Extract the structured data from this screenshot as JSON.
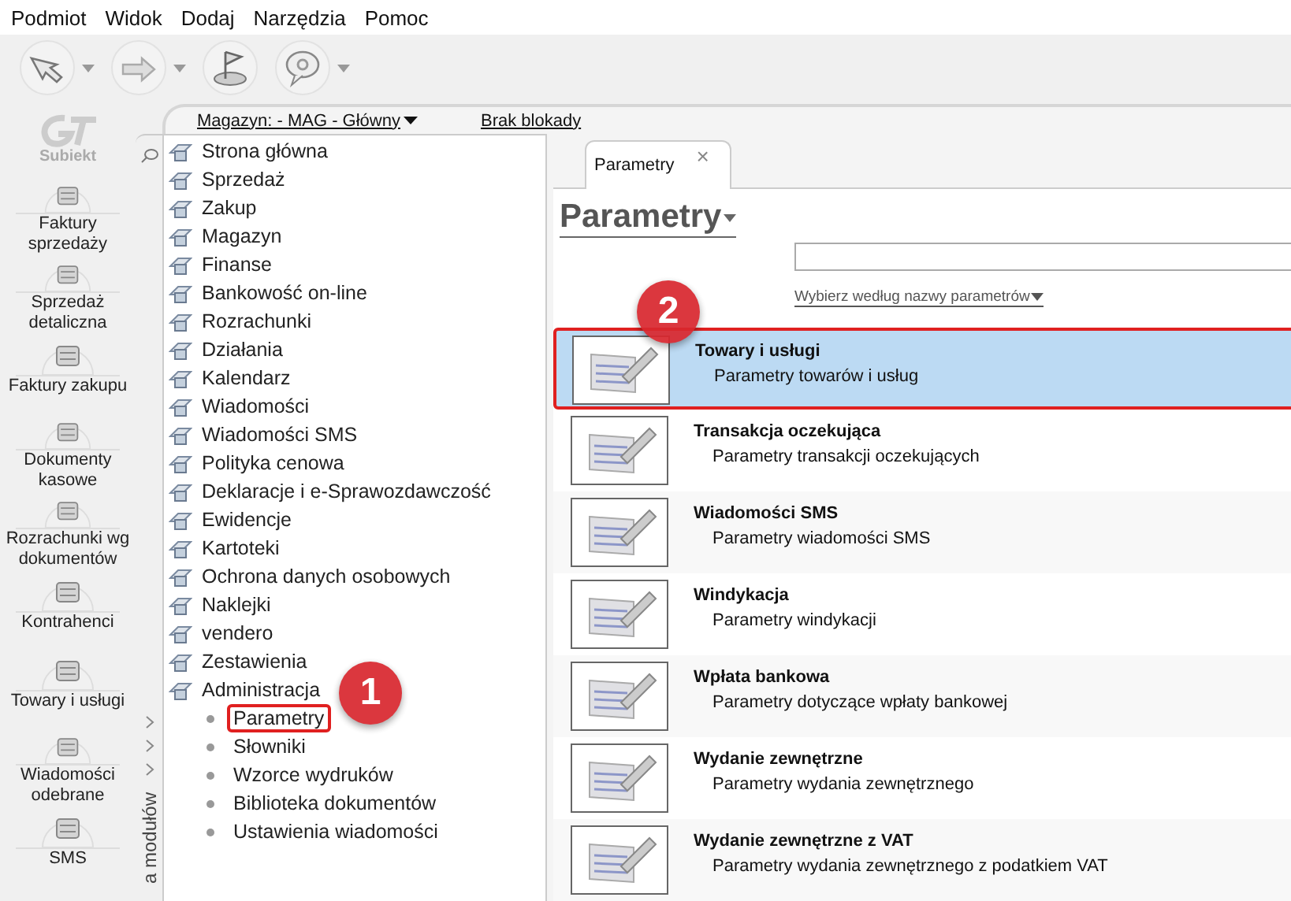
{
  "menu": [
    "Podmiot",
    "Widok",
    "Dodaj",
    "Narzędzia",
    "Pomoc"
  ],
  "logo": {
    "text": "Subiekt"
  },
  "sidebar": {
    "items": [
      {
        "label": "Faktury sprzedaży"
      },
      {
        "label": "Sprzedaż detaliczna"
      },
      {
        "label": "Faktury zakupu"
      },
      {
        "label": "Dokumenty kasowe"
      },
      {
        "label": "Rozrachunki wg dokumentów"
      },
      {
        "label": "Kontrahenci"
      },
      {
        "label": "Towary i usługi"
      },
      {
        "label": "Wiadomości odebrane"
      },
      {
        "label": "SMS"
      }
    ]
  },
  "header": {
    "warehouse": "Magazyn: - MAG - Główny",
    "lock": "Brak blokady"
  },
  "module_tree": {
    "strip_label": "a modułów",
    "items": [
      {
        "label": "Strona główna"
      },
      {
        "label": "Sprzedaż"
      },
      {
        "label": "Zakup"
      },
      {
        "label": "Magazyn"
      },
      {
        "label": "Finanse"
      },
      {
        "label": "Bankowość on-line"
      },
      {
        "label": "Rozrachunki"
      },
      {
        "label": "Działania"
      },
      {
        "label": "Kalendarz"
      },
      {
        "label": "Wiadomości"
      },
      {
        "label": "Wiadomości SMS"
      },
      {
        "label": "Polityka cenowa"
      },
      {
        "label": "Deklaracje i e-Sprawozdawczość"
      },
      {
        "label": "Ewidencje"
      },
      {
        "label": "Kartoteki"
      },
      {
        "label": "Ochrona danych osobowych"
      },
      {
        "label": "Naklejki"
      },
      {
        "label": "vendero"
      },
      {
        "label": "Zestawienia"
      },
      {
        "label": "Administracja",
        "children": [
          {
            "label": "Parametry",
            "highlighted": true
          },
          {
            "label": "Słowniki",
            "highlighted": false
          },
          {
            "label": "Wzorce wydruków",
            "highlighted": false
          },
          {
            "label": "Biblioteka dokumentów",
            "highlighted": false
          },
          {
            "label": "Ustawienia wiadomości",
            "highlighted": false
          }
        ]
      }
    ]
  },
  "tabs": [
    {
      "label": "Parametry",
      "selected": true,
      "close": "×"
    }
  ],
  "page_title": "Parametry",
  "filter": "Wybierz według nazwy parametrów",
  "params": [
    {
      "title": "Towary i usługi",
      "description": "Parametry towarów i usług",
      "selected": true,
      "highlighted": true
    },
    {
      "title": "Transakcja oczekująca",
      "description": "Parametry transakcji oczekujących",
      "selected": false,
      "highlighted": false
    },
    {
      "title": "Wiadomości SMS",
      "description": "Parametry wiadomości SMS",
      "selected": false,
      "highlighted": false
    },
    {
      "title": "Windykacja",
      "description": "Parametry windykacji",
      "selected": false,
      "highlighted": false
    },
    {
      "title": "Wpłata bankowa",
      "description": "Parametry dotyczące wpłaty bankowej",
      "selected": false,
      "highlighted": false
    },
    {
      "title": "Wydanie zewnętrzne",
      "description": "Parametry wydania zewnętrznego",
      "selected": false,
      "highlighted": false
    },
    {
      "title": "Wydanie zewnętrzne z VAT",
      "description": "Parametry wydania zewnętrznego z podatkiem VAT",
      "selected": false,
      "highlighted": false
    }
  ],
  "annotations": [
    {
      "label": "1"
    },
    {
      "label": "2"
    }
  ]
}
